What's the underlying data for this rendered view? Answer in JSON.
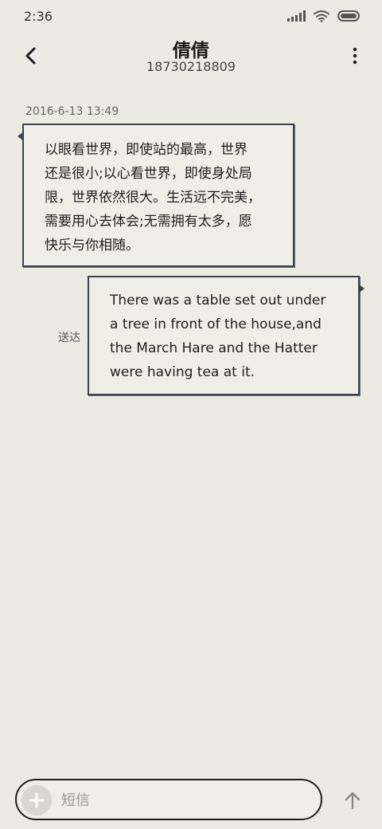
{
  "status_bar": {
    "time": "2:36",
    "icons": [
      "signal-icon",
      "wifi-icon",
      "battery-icon"
    ],
    "battery_level": 1.0
  },
  "header": {
    "contact_name": "倩倩",
    "contact_number": "18730218809",
    "icons": [
      "back-arrow-icon",
      "more-vertical-icon"
    ]
  },
  "messages": [
    {
      "direction": "incoming",
      "timestamp": "2016-6-13 13:49",
      "lines": [
        "以眼看世界，即使站的最高，世界",
        "还是很小;以心看世界，即使身处局",
        "限，世界依然很大。生活远不完美，",
        "需要用心去体会;无需拥有太多，愿",
        "快乐与你相随。"
      ]
    },
    {
      "direction": "outgoing",
      "status": "送达",
      "lines": [
        "There was a table set out under",
        "a tree in front of the house,and",
        "the March Hare and the Hatter",
        "were having tea at it."
      ]
    }
  ],
  "composer": {
    "placeholder": "短信",
    "value": "",
    "icons": [
      "plus-icon",
      "send-arrow-up-icon"
    ]
  },
  "colors": {
    "background": "#ecebe3",
    "bubble_border": "#3a4250",
    "text": "#1f1f1f"
  }
}
